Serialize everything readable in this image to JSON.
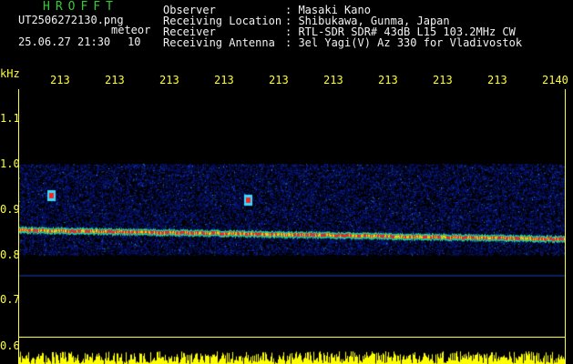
{
  "header": {
    "brand": "HROFFT",
    "filename": "UT2506272130.png",
    "meteor_label": "meteor",
    "datetime": "25.06.27 21:30",
    "count": "10",
    "labels": {
      "observer": "Observer",
      "location": "Receiving Location",
      "receiver": "Receiver",
      "antenna": "Receiving Antenna"
    },
    "values": {
      "observer": ": Masaki Kano",
      "location": ": Shibukawa, Gunma, Japan",
      "receiver": ": RTL-SDR SDR# 43dB L15 103.2MHz CW",
      "antenna": ": 3el Yagi(V) Az 330 for Vladivostok"
    }
  },
  "chart_data": {
    "type": "heatmap",
    "title": "",
    "ylabel": "kHz",
    "x_ticks": [
      "213",
      "213",
      "213",
      "213",
      "213",
      "213",
      "213",
      "213",
      "213",
      "2140"
    ],
    "y_ticks": [
      "1.1",
      "1.0",
      "0.9",
      "0.8",
      "0.7",
      "0.6"
    ],
    "ylim": [
      0.6,
      1.13
    ],
    "signal_band_khz": [
      0.8,
      1.0
    ],
    "carrier_line": {
      "start_khz": 0.855,
      "end_khz": 0.835,
      "color": "#ff2222"
    },
    "weak_line_khz": 0.755,
    "meteor_echoes": [
      {
        "x_frac": 0.06,
        "khz": 0.93
      },
      {
        "x_frac": 0.42,
        "khz": 0.92
      }
    ],
    "colors": {
      "background": "#000000",
      "noise": "#0a1a9a",
      "hot": "#ff2222",
      "level": "#ffff00",
      "axis": "#ffff33"
    }
  }
}
